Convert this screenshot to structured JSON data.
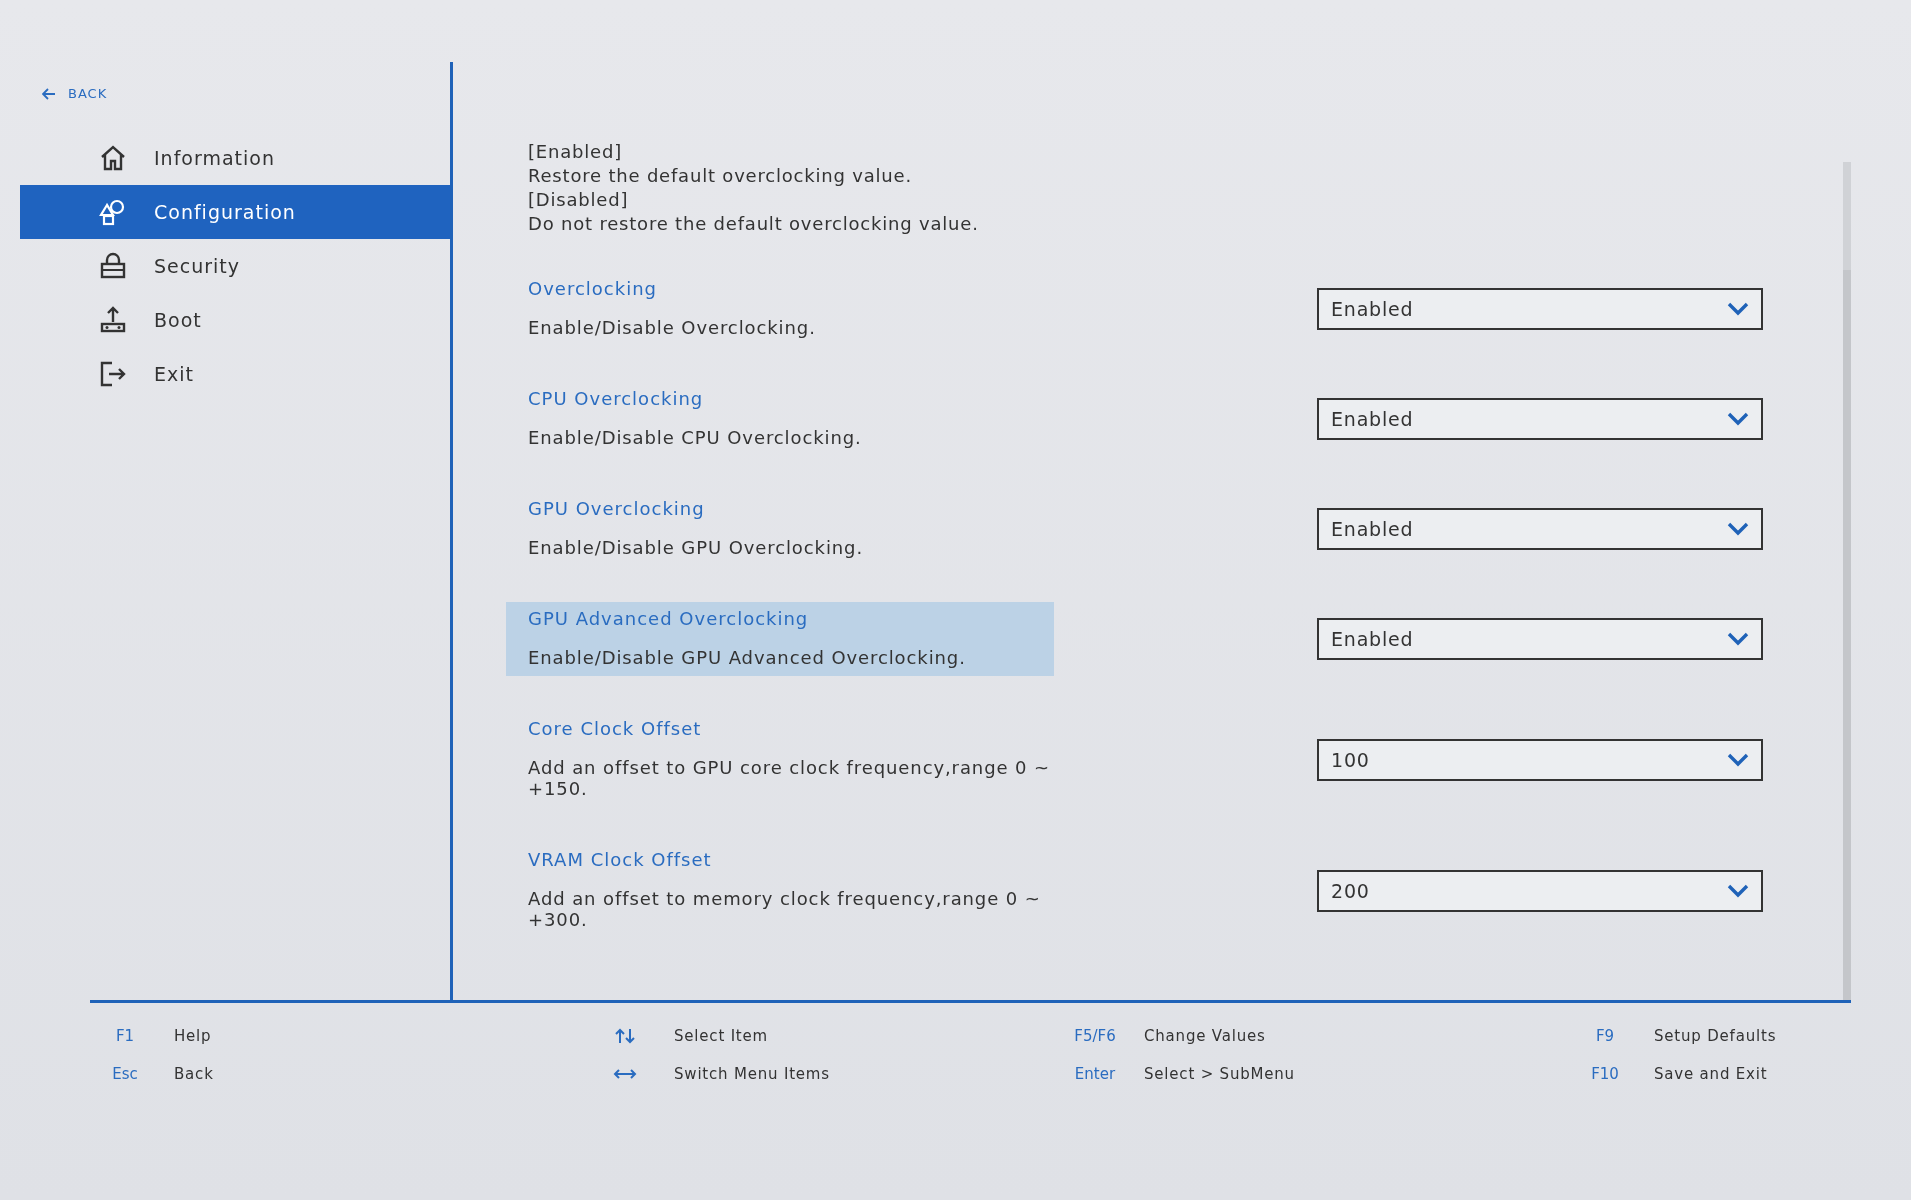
{
  "back": {
    "label": "BACK"
  },
  "sidebar": {
    "items": [
      {
        "label": "Information",
        "kind": "home",
        "selected": false
      },
      {
        "label": "Configuration",
        "kind": "shapes",
        "selected": true
      },
      {
        "label": "Security",
        "kind": "lock",
        "selected": false
      },
      {
        "label": "Boot",
        "kind": "boot",
        "selected": false
      },
      {
        "label": "Exit",
        "kind": "exit",
        "selected": false
      }
    ]
  },
  "help_text": [
    "[Enabled]",
    "Restore the default overclocking value.",
    "[Disabled]",
    "Do not restore the default overclocking value."
  ],
  "settings": [
    {
      "title": "Overclocking",
      "description": "Enable/Disable Overclocking.",
      "value": "Enabled",
      "selected": false
    },
    {
      "title": "CPU Overclocking",
      "description": "Enable/Disable CPU Overclocking.",
      "value": "Enabled",
      "selected": false
    },
    {
      "title": "GPU Overclocking",
      "description": "Enable/Disable GPU Overclocking.",
      "value": "Enabled",
      "selected": false
    },
    {
      "title": "GPU Advanced Overclocking",
      "description": "Enable/Disable GPU Advanced Overclocking.",
      "value": "Enabled",
      "selected": true
    },
    {
      "title": "Core Clock Offset",
      "description": "Add an offset to GPU core clock frequency,range 0 ~ +150.",
      "value": "100",
      "selected": false
    },
    {
      "title": "VRAM Clock Offset",
      "description": "Add an offset to memory clock frequency,range 0 ~ +300.",
      "value": "200",
      "selected": false
    }
  ],
  "footer": [
    [
      {
        "kind": "key",
        "key": "F1",
        "label": "Help"
      },
      {
        "kind": "key",
        "key": "Esc",
        "label": "Back"
      }
    ],
    [
      {
        "kind": "updown",
        "label": "Select Item"
      },
      {
        "kind": "leftright",
        "label": "Switch Menu Items"
      }
    ],
    [
      {
        "kind": "key",
        "key": "F5/F6",
        "label": "Change Values"
      },
      {
        "kind": "key",
        "key": "Enter",
        "label": "Select > SubMenu"
      }
    ],
    [
      {
        "kind": "key",
        "key": "F9",
        "label": "Setup Defaults"
      },
      {
        "kind": "key",
        "key": "F10",
        "label": "Save and Exit"
      }
    ]
  ]
}
